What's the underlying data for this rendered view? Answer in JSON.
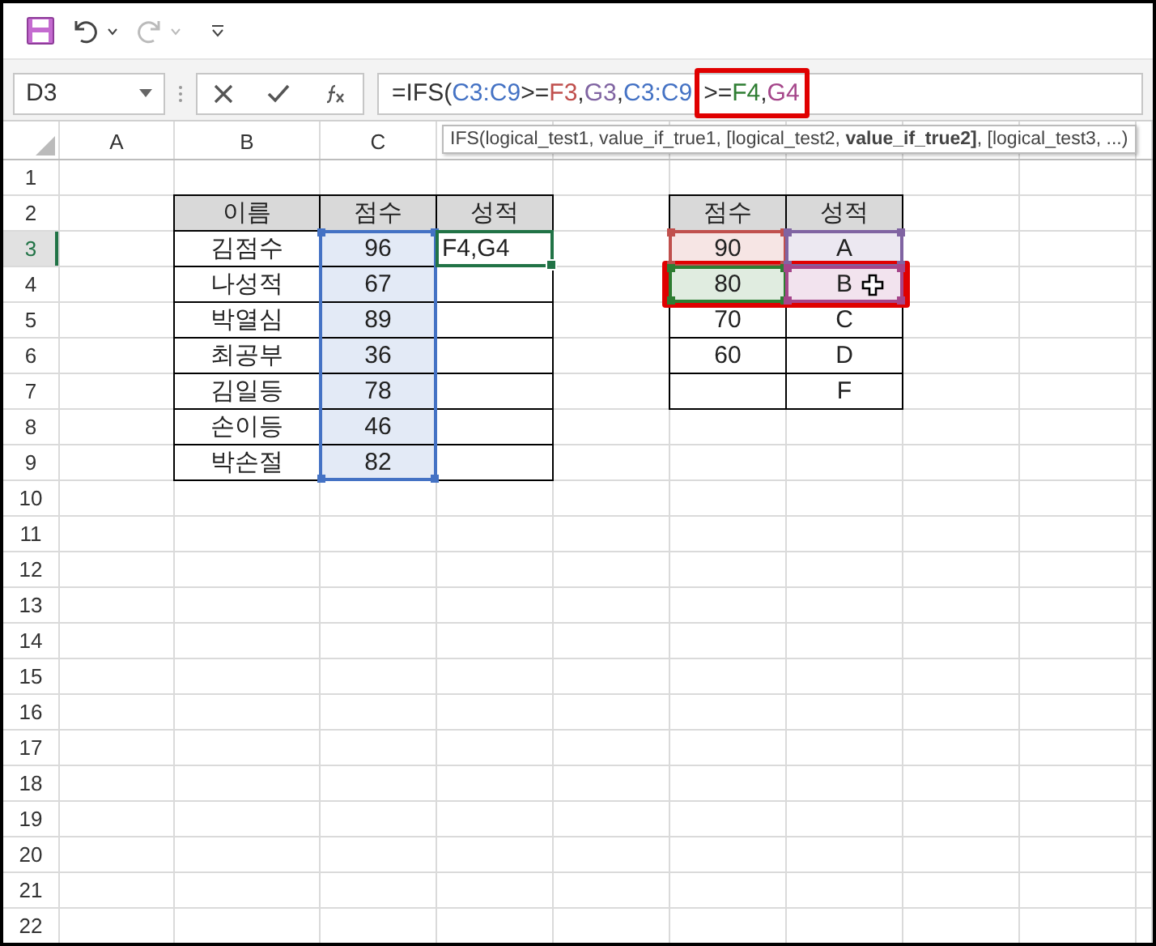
{
  "quick_access": {
    "redo": {
      "disabled": true
    }
  },
  "name_box": {
    "value": "D3"
  },
  "formula_bar": {
    "tokens": [
      {
        "text": "=IFS("
      },
      {
        "text": "C3:C9",
        "color": "#4472c4"
      },
      {
        "text": ">="
      },
      {
        "text": "F3",
        "color": "#c0504d"
      },
      {
        "text": ","
      },
      {
        "text": "G3",
        "color": "#8064a2"
      },
      {
        "text": ","
      },
      {
        "text": "C3:C9",
        "color": "#4472c4"
      }
    ],
    "boxed_tokens": [
      {
        "text": ">="
      },
      {
        "text": "F4",
        "color": "#2e7d32"
      },
      {
        "text": ","
      },
      {
        "text": "G4",
        "color": "#a5468a"
      }
    ]
  },
  "tooltip": {
    "text": "IFS(logical_test1, value_if_true1, [logical_test2, **value_if_true2]**, [logical_test3, ...)"
  },
  "column_headers": [
    "A",
    "B",
    "C"
  ],
  "row_numbers": [
    "1",
    "2",
    "3",
    "4",
    "5",
    "6",
    "7",
    "8",
    "9",
    "10",
    "11",
    "12",
    "13",
    "14",
    "15",
    "16",
    "17",
    "18",
    "19",
    "20",
    "21",
    "22"
  ],
  "score_table": {
    "headers": [
      "이름",
      "점수",
      "성적"
    ],
    "score_range": {
      "color": "#4472c4"
    },
    "rows": [
      {
        "name": "김점수",
        "score": "96",
        "grade": "F4,G4",
        "editing": true
      },
      {
        "name": "나성적",
        "score": "67",
        "editing": false
      },
      {
        "name": "박열심",
        "score": "89",
        "editing": false
      },
      {
        "name": "최공부",
        "score": "36",
        "editing": false
      },
      {
        "name": "김일등",
        "score": "78",
        "editing": false
      },
      {
        "name": "손이등",
        "score": "46",
        "editing": false
      },
      {
        "name": "박손절",
        "score": "82",
        "editing": false
      }
    ]
  },
  "grade_table": {
    "headers": [
      "점수",
      "성적"
    ],
    "rows": [
      {
        "score": {
          "text": "90",
          "color": "#c0504d"
        },
        "grade": {
          "text": "A",
          "color": "#8064a2"
        },
        "callout": false,
        "pointer": false
      },
      {
        "score": {
          "text": "80",
          "color": "#2e7d32"
        },
        "grade": {
          "text": "B",
          "color": "#a5468a"
        },
        "callout": true,
        "pointer": true
      },
      {
        "score": {
          "text": "70"
        },
        "grade": {
          "text": "C"
        },
        "callout": false,
        "pointer": false
      },
      {
        "score": {
          "text": "60"
        },
        "grade": {
          "text": "D"
        },
        "callout": false,
        "pointer": false
      },
      {
        "score": {},
        "grade": {
          "text": "F"
        },
        "callout": false,
        "pointer": false
      }
    ]
  }
}
